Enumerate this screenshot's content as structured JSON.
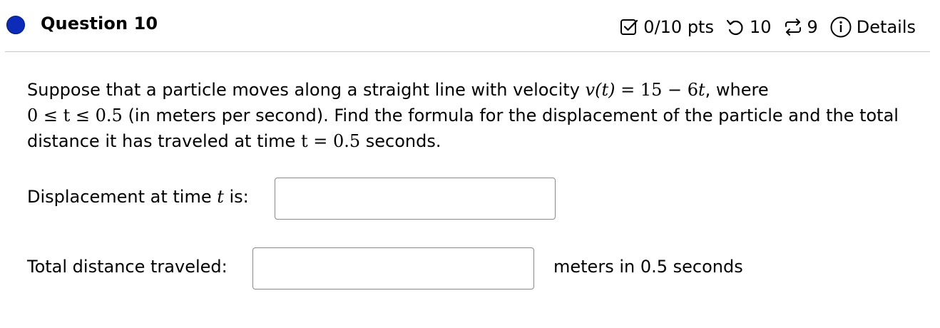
{
  "header": {
    "question_title": "Question 10",
    "points": "0/10 pts",
    "retries": "10",
    "submissions": "9",
    "details_label": "Details",
    "status_color": "#0b2bb8",
    "icons": {
      "points": "checkbox-icon",
      "retries": "undo-icon",
      "submissions": "repeat-icon",
      "details": "info-icon"
    }
  },
  "question": {
    "text_1": "Suppose that a particle moves along a straight line with velocity ",
    "math_velocity_lhs": "v(t)",
    "math_velocity_eq": " = 15 − 6",
    "math_velocity_var": "t",
    "text_2": ", where",
    "math_range": "0 ≤ t ≤ 0.5",
    "text_3": " (in meters per second). Find the formula for the displacement of the particle and the total distance it has traveled at time ",
    "math_time": "t = 0.5",
    "text_4": " seconds."
  },
  "displacement": {
    "label_prefix": "Displacement at time ",
    "label_var": "t",
    "label_suffix": " is:",
    "value": "",
    "placeholder": ""
  },
  "distance": {
    "label": "Total distance traveled:",
    "value": "",
    "placeholder": "",
    "unit_text": "meters in 0.5 seconds"
  }
}
